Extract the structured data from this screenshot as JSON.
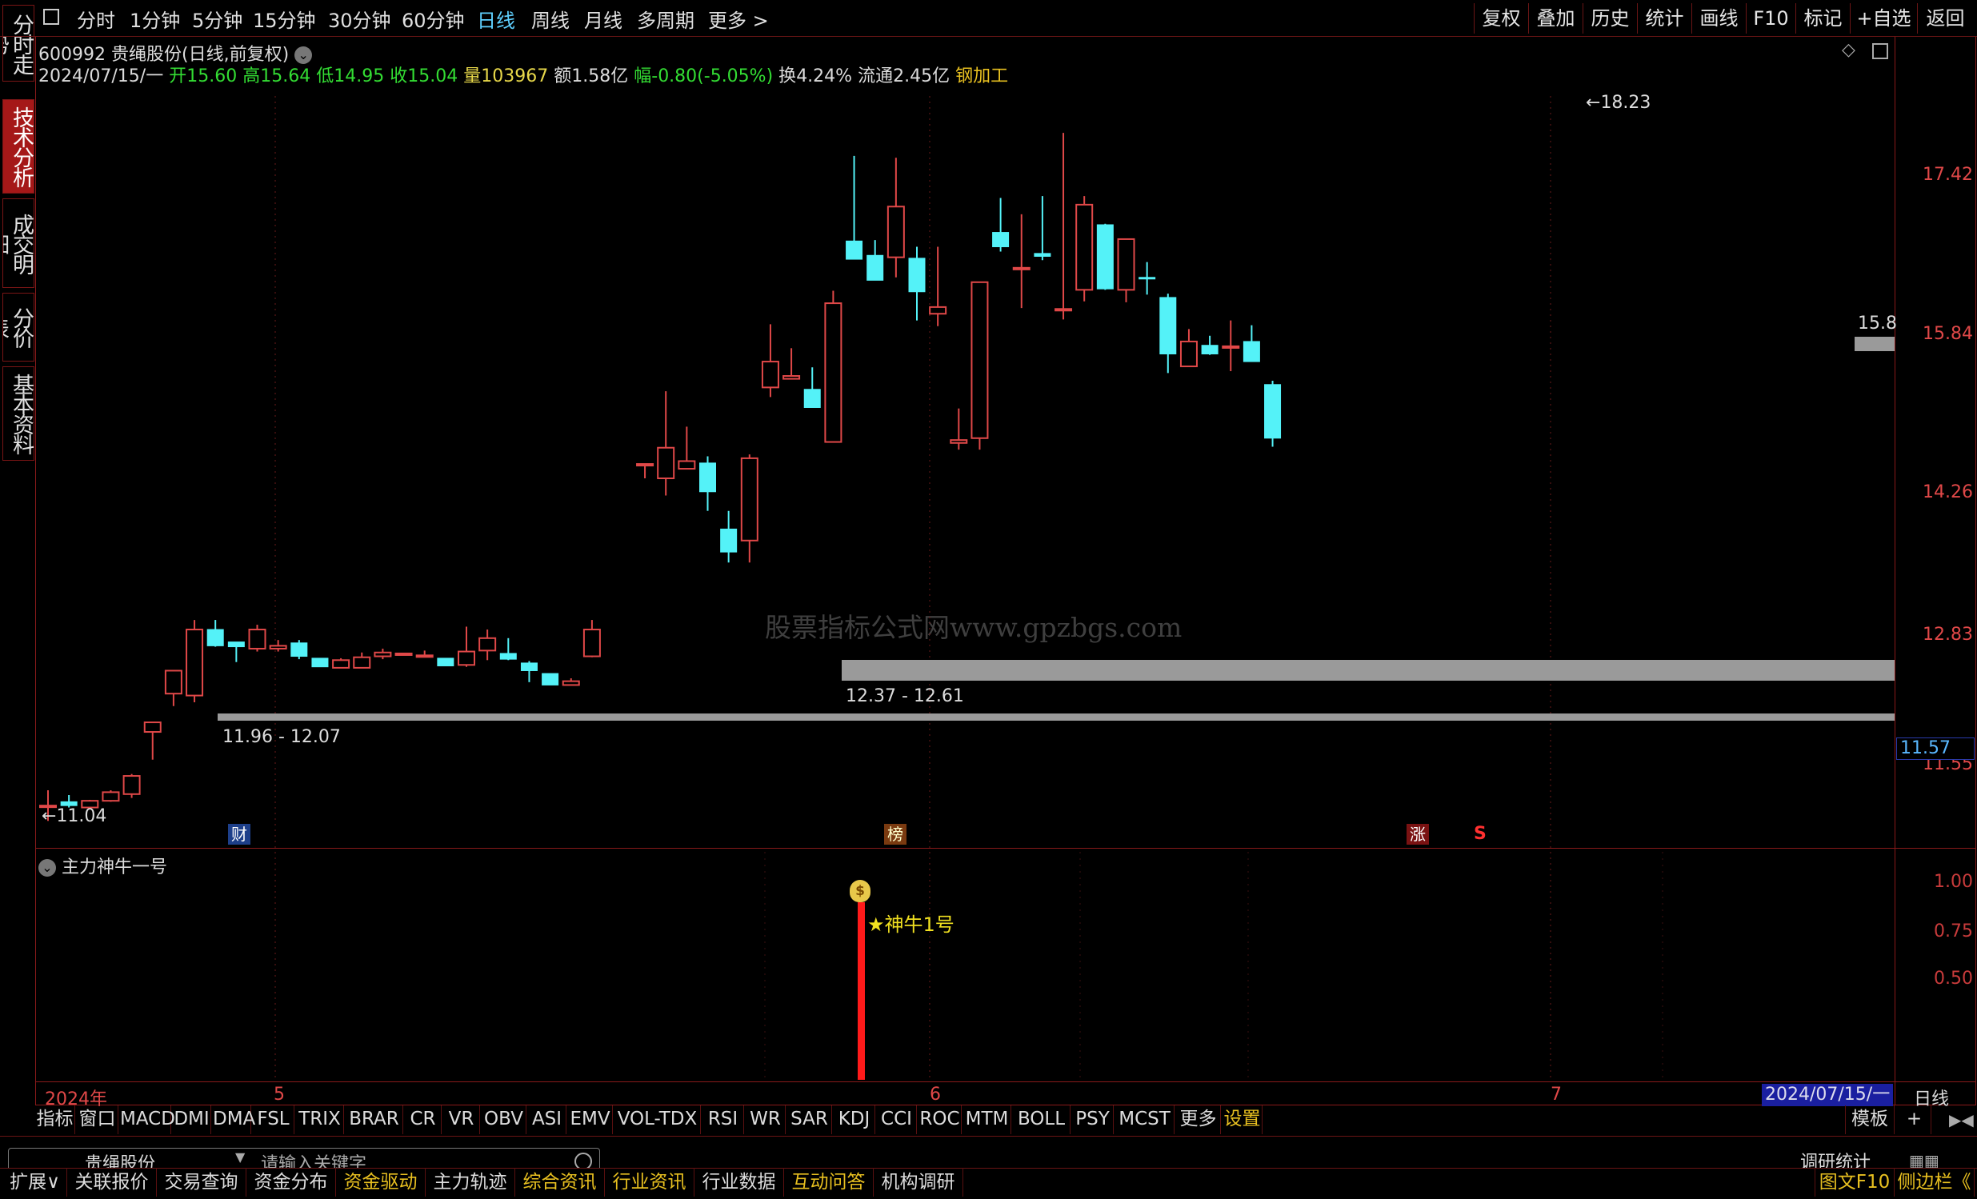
{
  "stock": {
    "code": "600992",
    "name": "贵绳股份",
    "mode": "(日线,前复权)"
  },
  "side_tabs": [
    "分时走势",
    "技术分析",
    "成交明细",
    "分价表",
    "基本资料"
  ],
  "period_tabs": [
    "分时",
    "1分钟",
    "5分钟",
    "15分钟",
    "30分钟",
    "60分钟",
    "日线",
    "周线",
    "月线",
    "多周期",
    "更多 >"
  ],
  "active_period": "日线",
  "right_buttons": [
    "复权",
    "叠加",
    "历史",
    "统计",
    "画线",
    "F10",
    "标记",
    "+自选",
    "返回"
  ],
  "info": {
    "date": "2024/07/15/一",
    "open_label": "开",
    "open": "15.60",
    "high_label": "高",
    "high": "15.64",
    "low_label": "低",
    "low": "14.95",
    "close_label": "收",
    "close": "15.04",
    "vol_label": "量",
    "vol": "103967",
    "amount_label": "额",
    "amount": "1.58亿",
    "change_label": "幅",
    "change": "-0.80(-5.05%)",
    "turnover_label": "换",
    "turnover": "4.24%",
    "float_label": "流通",
    "float": "2.45亿",
    "sector": "钢加工"
  },
  "price_axis": [
    "17.42",
    "15.84",
    "14.26",
    "12.83",
    "11.55"
  ],
  "current_price_tag": "11.57",
  "price_tag_right": "15.8",
  "annotations": {
    "high": "18.23",
    "low": "11.04",
    "zone1": "11.96 - 12.07",
    "zone2": "12.37 - 12.61"
  },
  "watermark": "股票指标公式网www.gpzbgs.com",
  "event_markers": {
    "cai": "财",
    "bang": "榜",
    "zhang": "涨",
    "s": "S"
  },
  "indicator": {
    "name": "主力神牛一号",
    "signal_label": "★神牛1号",
    "axis": [
      "1.00",
      "0.75",
      "0.50"
    ]
  },
  "date_axis": {
    "year": "2024年",
    "m5": "5",
    "m6": "6",
    "m7": "7",
    "current": "2024/07/15/一",
    "period": "日线"
  },
  "indicator_tabs": [
    "指标",
    "窗口",
    "MACD",
    "DMI",
    "DMA",
    "FSL",
    "TRIX",
    "BRAR",
    "CR",
    "VR",
    "OBV",
    "ASI",
    "EMV",
    "VOL-TDX",
    "RSI",
    "WR",
    "SAR",
    "KDJ",
    "CCI",
    "ROC",
    "MTM",
    "BOLL",
    "PSY",
    "MCST",
    "更多",
    "设置"
  ],
  "template_label": "模板",
  "plus_label": "+",
  "search": {
    "stock": "贵绳股份",
    "placeholder": "请输入关键字"
  },
  "research_label": "调研统计",
  "bottom_tabs": [
    "扩展∨",
    "关联报价",
    "交易查询",
    "资金分布",
    "资金驱动",
    "主力轨迹",
    "综合资讯",
    "行业资讯",
    "行业数据",
    "互动问答",
    "机构调研"
  ],
  "bottom_right": {
    "f10": "图文F10",
    "side": "侧边栏《"
  },
  "colors": {
    "up": "#e04848",
    "down": "#54f2f8",
    "zone": "#9a9a9a",
    "signal": "#ff1a1a",
    "active_tab": "#5fd0ff",
    "frame": "#8a1a1a"
  },
  "chart_data": {
    "type": "candlestick",
    "price_range": [
      10.8,
      18.9
    ],
    "candles": [
      {
        "o": 11.2,
        "h": 11.36,
        "l": 11.04,
        "c": 11.2
      },
      {
        "o": 11.24,
        "h": 11.31,
        "l": 11.18,
        "c": 11.2
      },
      {
        "o": 11.18,
        "h": 11.26,
        "l": 11.18,
        "c": 11.25
      },
      {
        "o": 11.25,
        "h": 11.36,
        "l": 11.24,
        "c": 11.34
      },
      {
        "o": 11.32,
        "h": 11.53,
        "l": 11.28,
        "c": 11.51
      },
      {
        "o": 11.97,
        "h": 12.07,
        "l": 11.68,
        "c": 12.07
      },
      {
        "o": 12.37,
        "h": 12.61,
        "l": 12.24,
        "c": 12.61
      },
      {
        "o": 12.35,
        "h": 13.14,
        "l": 12.28,
        "c": 13.04
      },
      {
        "o": 13.04,
        "h": 13.14,
        "l": 12.86,
        "c": 12.87
      },
      {
        "o": 12.91,
        "h": 12.91,
        "l": 12.7,
        "c": 12.86
      },
      {
        "o": 12.84,
        "h": 13.09,
        "l": 12.81,
        "c": 13.04
      },
      {
        "o": 12.84,
        "h": 12.93,
        "l": 12.81,
        "c": 12.87
      },
      {
        "o": 12.9,
        "h": 12.93,
        "l": 12.73,
        "c": 12.76
      },
      {
        "o": 12.74,
        "h": 12.73,
        "l": 12.65,
        "c": 12.65
      },
      {
        "o": 12.64,
        "h": 12.74,
        "l": 12.64,
        "c": 12.72
      },
      {
        "o": 12.64,
        "h": 12.8,
        "l": 12.64,
        "c": 12.75
      },
      {
        "o": 12.76,
        "h": 12.84,
        "l": 12.73,
        "c": 12.8
      },
      {
        "o": 12.79,
        "h": 12.79,
        "l": 12.78,
        "c": 12.79
      },
      {
        "o": 12.76,
        "h": 12.82,
        "l": 12.75,
        "c": 12.77
      },
      {
        "o": 12.74,
        "h": 12.74,
        "l": 12.66,
        "c": 12.66
      },
      {
        "o": 12.67,
        "h": 13.07,
        "l": 12.65,
        "c": 12.81
      },
      {
        "o": 12.82,
        "h": 13.04,
        "l": 12.72,
        "c": 12.95
      },
      {
        "o": 12.79,
        "h": 12.95,
        "l": 12.72,
        "c": 12.73
      },
      {
        "o": 12.69,
        "h": 12.71,
        "l": 12.49,
        "c": 12.61
      },
      {
        "o": 12.58,
        "h": 12.58,
        "l": 12.46,
        "c": 12.46
      },
      {
        "o": 12.46,
        "h": 12.53,
        "l": 12.46,
        "c": 12.5
      },
      {
        "o": 12.76,
        "h": 13.14,
        "l": 12.75,
        "c": 13.04
      },
      {
        "o": 14.77,
        "h": 14.77,
        "l": 14.62,
        "c": 14.77
      },
      {
        "o": 14.62,
        "h": 15.53,
        "l": 14.44,
        "c": 14.94
      },
      {
        "o": 14.72,
        "h": 15.16,
        "l": 14.72,
        "c": 14.8
      },
      {
        "o": 14.78,
        "h": 14.85,
        "l": 14.28,
        "c": 14.48
      },
      {
        "o": 14.09,
        "h": 14.28,
        "l": 13.74,
        "c": 13.85
      },
      {
        "o": 13.97,
        "h": 14.87,
        "l": 13.74,
        "c": 14.83
      },
      {
        "o": 15.57,
        "h": 16.23,
        "l": 15.47,
        "c": 15.84
      },
      {
        "o": 15.66,
        "h": 15.98,
        "l": 15.66,
        "c": 15.69
      },
      {
        "o": 15.55,
        "h": 15.78,
        "l": 15.38,
        "c": 15.36
      },
      {
        "o": 15.0,
        "h": 16.58,
        "l": 15.0,
        "c": 16.45
      },
      {
        "o": 17.1,
        "h": 17.99,
        "l": 16.91,
        "c": 16.91
      },
      {
        "o": 16.95,
        "h": 17.11,
        "l": 16.75,
        "c": 16.69
      },
      {
        "o": 16.93,
        "h": 17.97,
        "l": 16.72,
        "c": 17.46
      },
      {
        "o": 16.92,
        "h": 17.04,
        "l": 16.27,
        "c": 16.57
      },
      {
        "o": 16.34,
        "h": 17.04,
        "l": 16.21,
        "c": 16.41
      },
      {
        "o": 14.99,
        "h": 15.35,
        "l": 14.92,
        "c": 15.02
      },
      {
        "o": 15.04,
        "h": 16.57,
        "l": 14.92,
        "c": 16.67
      },
      {
        "o": 17.19,
        "h": 17.55,
        "l": 16.99,
        "c": 17.04
      },
      {
        "o": 16.82,
        "h": 17.38,
        "l": 16.4,
        "c": 16.82
      },
      {
        "o": 16.97,
        "h": 17.57,
        "l": 16.9,
        "c": 16.94
      },
      {
        "o": 16.39,
        "h": 18.23,
        "l": 16.28,
        "c": 16.39
      },
      {
        "o": 16.59,
        "h": 17.57,
        "l": 16.47,
        "c": 17.48
      },
      {
        "o": 17.27,
        "h": 17.28,
        "l": 16.59,
        "c": 16.6
      },
      {
        "o": 16.59,
        "h": 17.12,
        "l": 16.46,
        "c": 17.12
      },
      {
        "o": 16.72,
        "h": 16.88,
        "l": 16.54,
        "c": 16.71
      },
      {
        "o": 16.51,
        "h": 16.55,
        "l": 15.72,
        "c": 15.92
      },
      {
        "o": 15.79,
        "h": 16.18,
        "l": 15.79,
        "c": 16.05
      },
      {
        "o": 16.01,
        "h": 16.11,
        "l": 15.91,
        "c": 15.92
      },
      {
        "o": 16.0,
        "h": 16.27,
        "l": 15.74,
        "c": 16.0
      },
      {
        "o": 16.05,
        "h": 16.22,
        "l": 15.87,
        "c": 15.84
      },
      {
        "o": 15.6,
        "h": 15.64,
        "l": 14.95,
        "c": 15.04
      }
    ],
    "zones": [
      {
        "label": "11.96 - 12.07",
        "low": 11.96,
        "high": 12.07
      },
      {
        "label": "12.37 - 12.61",
        "low": 12.37,
        "high": 12.61
      }
    ],
    "indicator_signal": {
      "value": 0.95
    }
  }
}
